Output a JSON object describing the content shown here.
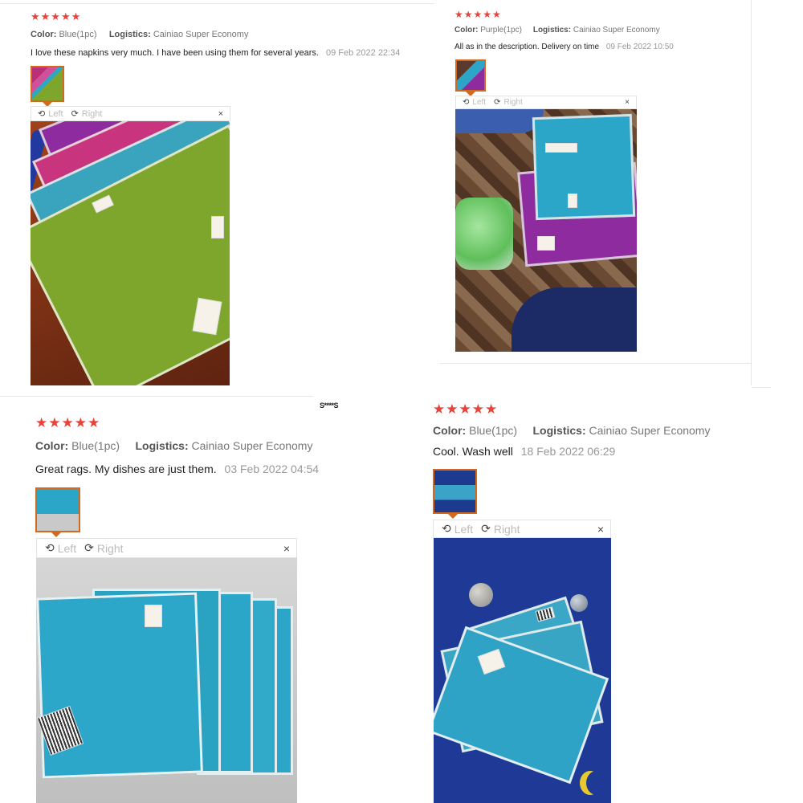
{
  "reviews": [
    {
      "stars": "★★★★★",
      "color_label": "Color:",
      "color_value": "Blue(1pc)",
      "logistics_label": "Logistics:",
      "logistics_value": "Cainiao Super Economy",
      "comment": "I love these napkins very much. I have been using them for several years.",
      "date": "09 Feb 2022 22:34",
      "viewer": {
        "left": "Left",
        "right": "Right",
        "close": "×"
      }
    },
    {
      "stars": "★★★★★",
      "color_label": "Color:",
      "color_value": "Purple(1pc)",
      "logistics_label": "Logistics:",
      "logistics_value": "Cainiao Super Economy",
      "comment": "All as in the description. Delivery on time",
      "date": "09 Feb 2022 10:50",
      "viewer": {
        "left": "Left",
        "right": "Right",
        "close": "×"
      }
    },
    {
      "stars": "★★★★★",
      "color_label": "Color:",
      "color_value": "Blue(1pc)",
      "logistics_label": "Logistics:",
      "logistics_value": "Cainiao Super Economy",
      "comment": "Great rags. My dishes are just them.",
      "date": "03 Feb 2022 04:54",
      "viewer": {
        "left": "Left",
        "right": "Right",
        "close": "×"
      }
    },
    {
      "stars": "★★★★★",
      "color_label": "Color:",
      "color_value": "Blue(1pc)",
      "logistics_label": "Logistics:",
      "logistics_value": "Cainiao Super Economy",
      "comment": "Cool. Wash well",
      "date": "18 Feb 2022 06:29",
      "viewer": {
        "left": "Left",
        "right": "Right",
        "close": "×"
      }
    }
  ],
  "stray_text": "S****S",
  "icons": {
    "rotate_left": "rotate-left-icon",
    "rotate_right": "rotate-right-icon",
    "close": "close-icon",
    "star": "star-icon"
  },
  "colors": {
    "star": "#e8423b",
    "thumb_border": "#d2691e",
    "towel_green": "#7ea62c",
    "towel_blue": "#2ba6c8",
    "towel_purple": "#8e2b9e",
    "towel_pink": "#c8357e"
  }
}
